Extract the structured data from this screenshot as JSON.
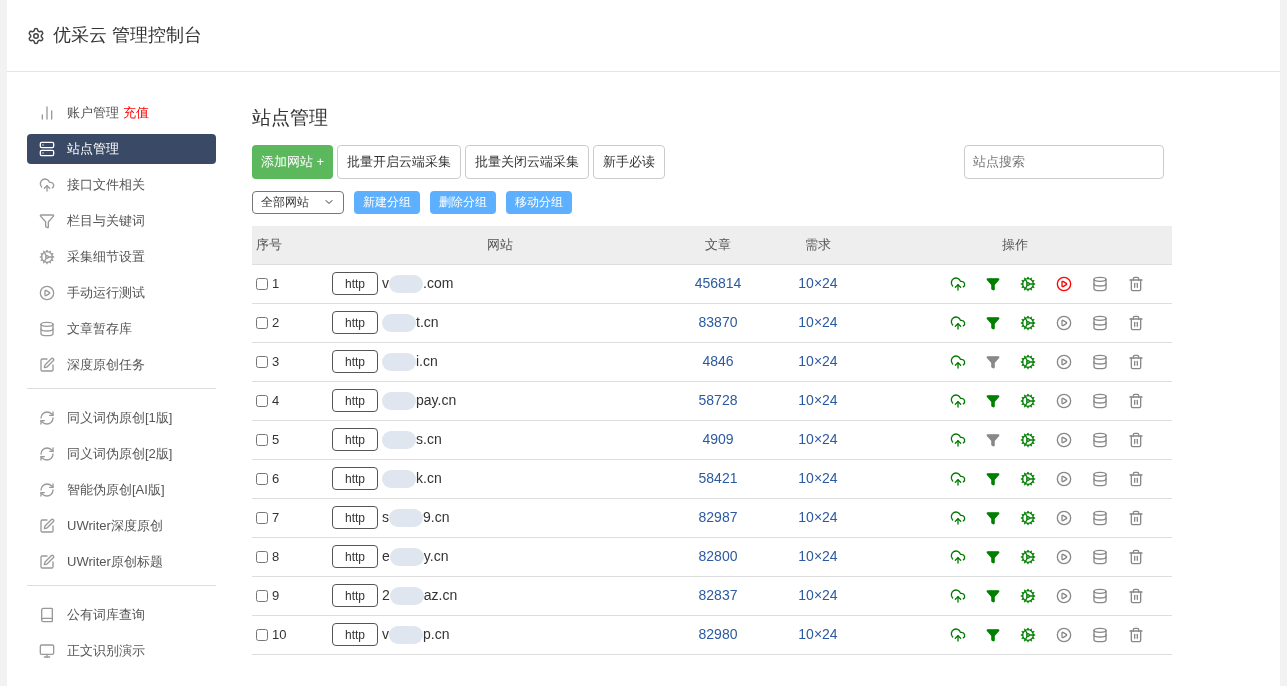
{
  "header": {
    "title": "优采云 管理控制台"
  },
  "sidebar": {
    "groups": [
      {
        "items": [
          {
            "kind": "chart",
            "label": "账户管理",
            "badge": "充值",
            "selected": false
          },
          {
            "kind": "server",
            "label": "站点管理",
            "selected": true
          },
          {
            "kind": "cloud",
            "label": "接口文件相关",
            "selected": false
          },
          {
            "kind": "filter",
            "label": "栏目与关键词",
            "selected": false
          },
          {
            "kind": "gears",
            "label": "采集细节设置",
            "selected": false
          },
          {
            "kind": "play",
            "label": "手动运行测试",
            "selected": false
          },
          {
            "kind": "database",
            "label": "文章暂存库",
            "selected": false
          },
          {
            "kind": "edit",
            "label": "深度原创任务",
            "selected": false
          }
        ]
      },
      {
        "items": [
          {
            "kind": "refresh",
            "label": "同义词伪原创[1版]",
            "selected": false
          },
          {
            "kind": "refresh",
            "label": "同义词伪原创[2版]",
            "selected": false
          },
          {
            "kind": "refresh",
            "label": "智能伪原创[AI版]",
            "selected": false
          },
          {
            "kind": "edit",
            "label": "UWriter深度原创",
            "selected": false
          },
          {
            "kind": "edit",
            "label": "UWriter原创标题",
            "selected": false
          }
        ]
      },
      {
        "items": [
          {
            "kind": "book",
            "label": "公有词库查询",
            "selected": false
          },
          {
            "kind": "monitor",
            "label": "正文识别演示",
            "selected": false
          }
        ]
      }
    ]
  },
  "main": {
    "title": "站点管理",
    "buttons": [
      {
        "kind": "primary",
        "label": "添加网站 +"
      },
      {
        "kind": "default",
        "label": "批量开启云端采集"
      },
      {
        "kind": "default",
        "label": "批量关闭云端采集"
      },
      {
        "kind": "default",
        "label": "新手必读"
      }
    ],
    "search": {
      "placeholder": "站点搜索"
    },
    "group_select": {
      "value": "全部网站"
    },
    "group_buttons": [
      "新建分组",
      "删除分组",
      "移动分组"
    ],
    "table": {
      "columns": [
        "序号",
        "网站",
        "文章",
        "需求",
        "操作"
      ],
      "rows": [
        {
          "checked": false,
          "index": "1",
          "protocol": "http",
          "site_start": "v",
          "site_end": ".com",
          "articles": "456814",
          "demand": "10×24",
          "filter_on": true,
          "running": true
        },
        {
          "checked": false,
          "index": "2",
          "protocol": "http",
          "site_end": "t.cn",
          "articles": "83870",
          "demand": "10×24",
          "filter_on": true,
          "running": false
        },
        {
          "checked": false,
          "index": "3",
          "protocol": "http",
          "site_end": "i.cn",
          "articles": "4846",
          "demand": "10×24",
          "filter_on": false,
          "running": false
        },
        {
          "checked": false,
          "index": "4",
          "protocol": "http",
          "site_end": "pay.cn",
          "articles": "58728",
          "demand": "10×24",
          "filter_on": true,
          "running": false
        },
        {
          "checked": false,
          "index": "5",
          "protocol": "http",
          "site_end": "s.cn",
          "articles": "4909",
          "demand": "10×24",
          "filter_on": false,
          "running": false
        },
        {
          "checked": false,
          "index": "6",
          "protocol": "http",
          "site_end": "k.cn",
          "articles": "58421",
          "demand": "10×24",
          "filter_on": true,
          "running": false
        },
        {
          "checked": false,
          "index": "7",
          "protocol": "http",
          "site_start": "s",
          "site_end": "9.cn",
          "articles": "82987",
          "demand": "10×24",
          "filter_on": true,
          "running": false
        },
        {
          "checked": false,
          "index": "8",
          "protocol": "http",
          "site_start": "e",
          "site_end": "y.cn",
          "articles": "82800",
          "demand": "10×24",
          "filter_on": true,
          "running": false
        },
        {
          "checked": false,
          "index": "9",
          "protocol": "http",
          "site_start": "2",
          "site_end": "az.cn",
          "articles": "82837",
          "demand": "10×24",
          "filter_on": true,
          "running": false
        },
        {
          "checked": false,
          "index": "10",
          "protocol": "http",
          "site_start": "v",
          "site_end": "p.cn",
          "articles": "82980",
          "demand": "10×24",
          "filter_on": true,
          "running": false
        }
      ]
    }
  }
}
